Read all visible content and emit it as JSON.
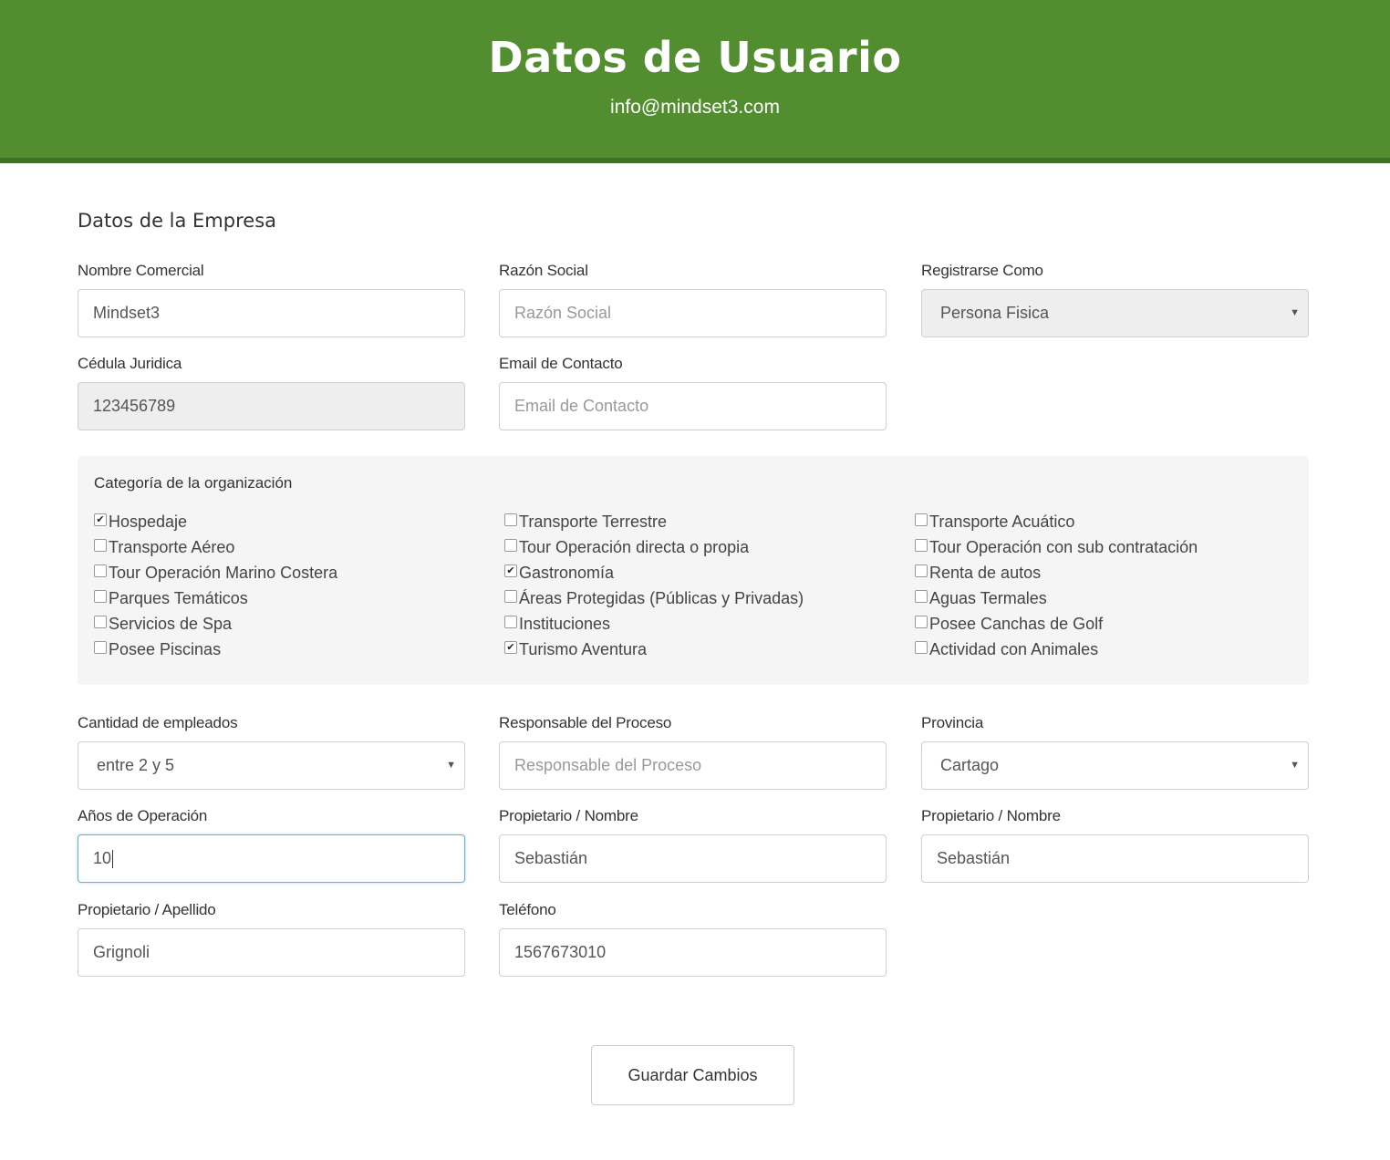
{
  "header": {
    "title": "Datos de Usuario",
    "email": "info@mindset3.com",
    "color": "#528d30"
  },
  "section_title": "Datos de la Empresa",
  "fields": {
    "nombre_comercial": {
      "label": "Nombre Comercial",
      "value": "Mindset3"
    },
    "razon_social": {
      "label": "Razón Social",
      "placeholder": "Razón Social"
    },
    "registrarse_como": {
      "label": "Registrarse Como",
      "value": "Persona Fisica"
    },
    "cedula_juridica": {
      "label": "Cédula Juridica",
      "value": "123456789"
    },
    "email_contacto": {
      "label": "Email de Contacto",
      "placeholder": "Email de Contacto"
    },
    "cantidad_empleados": {
      "label": "Cantidad de empleados",
      "value": "entre 2 y 5"
    },
    "responsable_proceso": {
      "label": "Responsable del Proceso",
      "placeholder": "Responsable del Proceso"
    },
    "provincia": {
      "label": "Provincia",
      "value": "Cartago"
    },
    "anos_operacion": {
      "label": "Años de Operación",
      "value": "10"
    },
    "propietario_nombre_1": {
      "label": "Propietario / Nombre",
      "value": "Sebastián"
    },
    "propietario_nombre_2": {
      "label": "Propietario / Nombre",
      "value": "Sebastián"
    },
    "propietario_apellido": {
      "label": "Propietario / Apellido",
      "value": "Grignoli"
    },
    "telefono": {
      "label": "Teléfono",
      "value": "1567673010"
    }
  },
  "categories": {
    "title": "Categoría de la organización",
    "columns": [
      [
        {
          "label": "Hospedaje",
          "checked": true
        },
        {
          "label": "Transporte Aéreo",
          "checked": false
        },
        {
          "label": "Tour Operación Marino Costera",
          "checked": false
        },
        {
          "label": "Parques Temáticos",
          "checked": false
        },
        {
          "label": "Servicios de Spa",
          "checked": false
        },
        {
          "label": "Posee Piscinas",
          "checked": false
        }
      ],
      [
        {
          "label": "Transporte Terrestre",
          "checked": false
        },
        {
          "label": "Tour Operación directa o propia",
          "checked": false
        },
        {
          "label": "Gastronomía",
          "checked": true
        },
        {
          "label": "Áreas Protegidas (Públicas y Privadas)",
          "checked": false
        },
        {
          "label": "Instituciones",
          "checked": false
        },
        {
          "label": "Turismo Aventura",
          "checked": true
        }
      ],
      [
        {
          "label": "Transporte Acuático",
          "checked": false
        },
        {
          "label": "Tour Operación con sub contratación",
          "checked": false
        },
        {
          "label": "Renta de autos",
          "checked": false
        },
        {
          "label": "Aguas Termales",
          "checked": false
        },
        {
          "label": "Posee Canchas de Golf",
          "checked": false
        },
        {
          "label": "Actividad con Animales",
          "checked": false
        }
      ]
    ]
  },
  "save_button": "Guardar Cambios"
}
